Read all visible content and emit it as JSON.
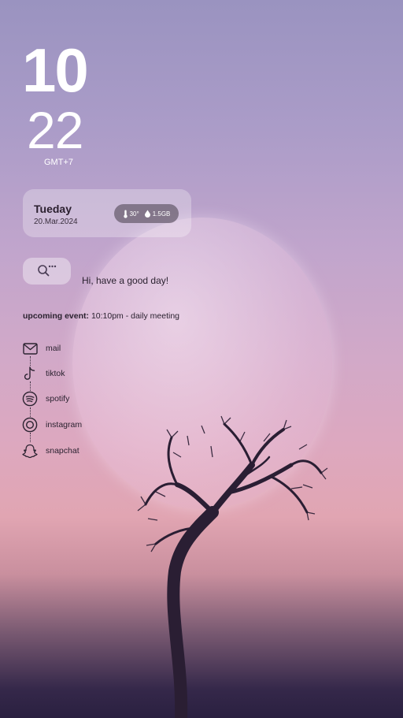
{
  "clock": {
    "hour": "10",
    "minute": "22",
    "timezone": "GMT+7"
  },
  "date_card": {
    "day": "Tueday",
    "date": "20.Mar.2024",
    "temperature": "30°",
    "storage": "1.5GB"
  },
  "search": {
    "icon": "search-icon"
  },
  "greeting": "Hi, have a good day!",
  "event": {
    "label": "upcoming event:",
    "text": "10:10pm - daily meeting"
  },
  "apps": [
    {
      "label": "mail",
      "icon": "mail-icon"
    },
    {
      "label": "tiktok",
      "icon": "tiktok-icon"
    },
    {
      "label": "spotify",
      "icon": "spotify-icon"
    },
    {
      "label": "instagram",
      "icon": "instagram-icon"
    },
    {
      "label": "snapchat",
      "icon": "snapchat-icon"
    }
  ]
}
